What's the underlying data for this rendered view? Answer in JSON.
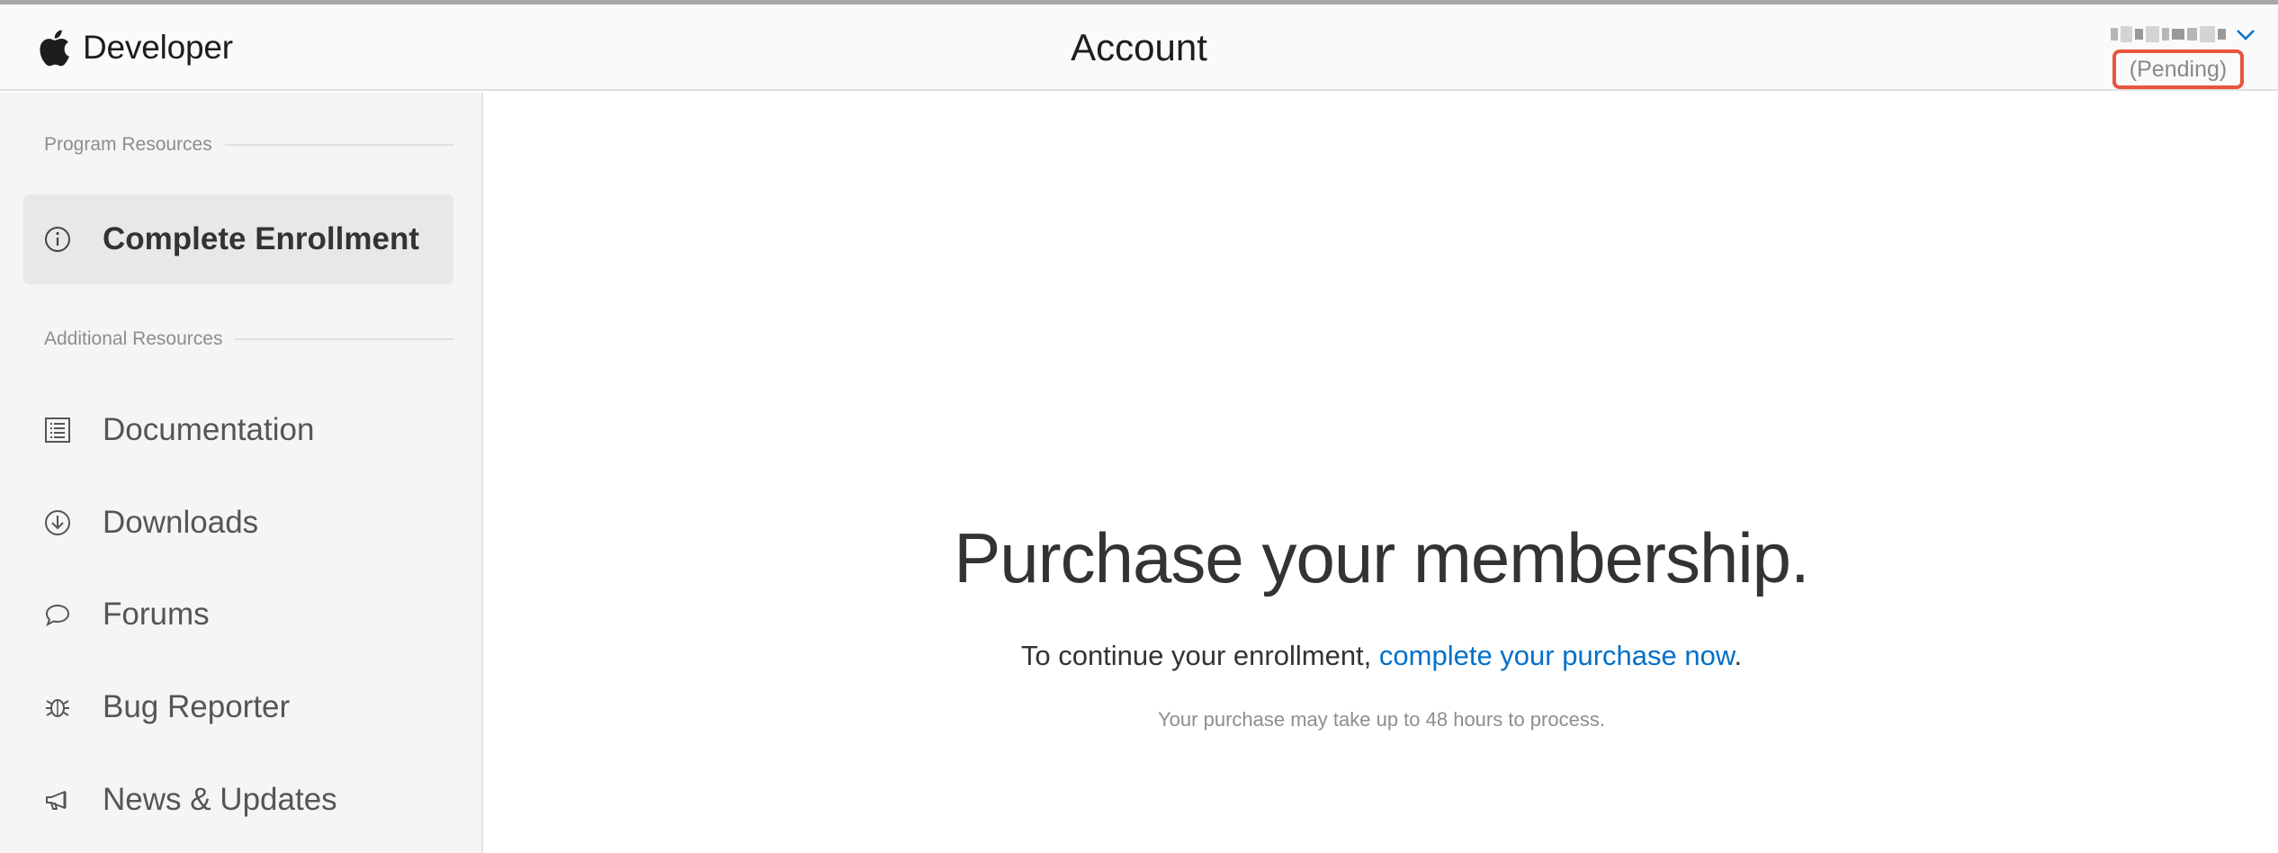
{
  "header": {
    "brand": "Developer",
    "title": "Account",
    "account_status": "(Pending)"
  },
  "sidebar": {
    "program_resources_label": "Program Resources",
    "additional_resources_label": "Additional Resources",
    "items": [
      {
        "label": "Complete Enrollment",
        "icon": "info-icon",
        "active": true
      },
      {
        "label": "Documentation",
        "icon": "document-icon"
      },
      {
        "label": "Downloads",
        "icon": "download-icon"
      },
      {
        "label": "Forums",
        "icon": "speech-bubble-icon"
      },
      {
        "label": "Bug Reporter",
        "icon": "bug-icon"
      },
      {
        "label": "News & Updates",
        "icon": "megaphone-icon"
      }
    ]
  },
  "main": {
    "headline": "Purchase your membership.",
    "subline_prefix": "To continue your enrollment, ",
    "subline_link": "complete your purchase now",
    "subline_suffix": ".",
    "note": "Your purchase may take up to 48 hours to process."
  },
  "colors": {
    "link": "#0070c9",
    "highlight_border": "#e8553c"
  }
}
